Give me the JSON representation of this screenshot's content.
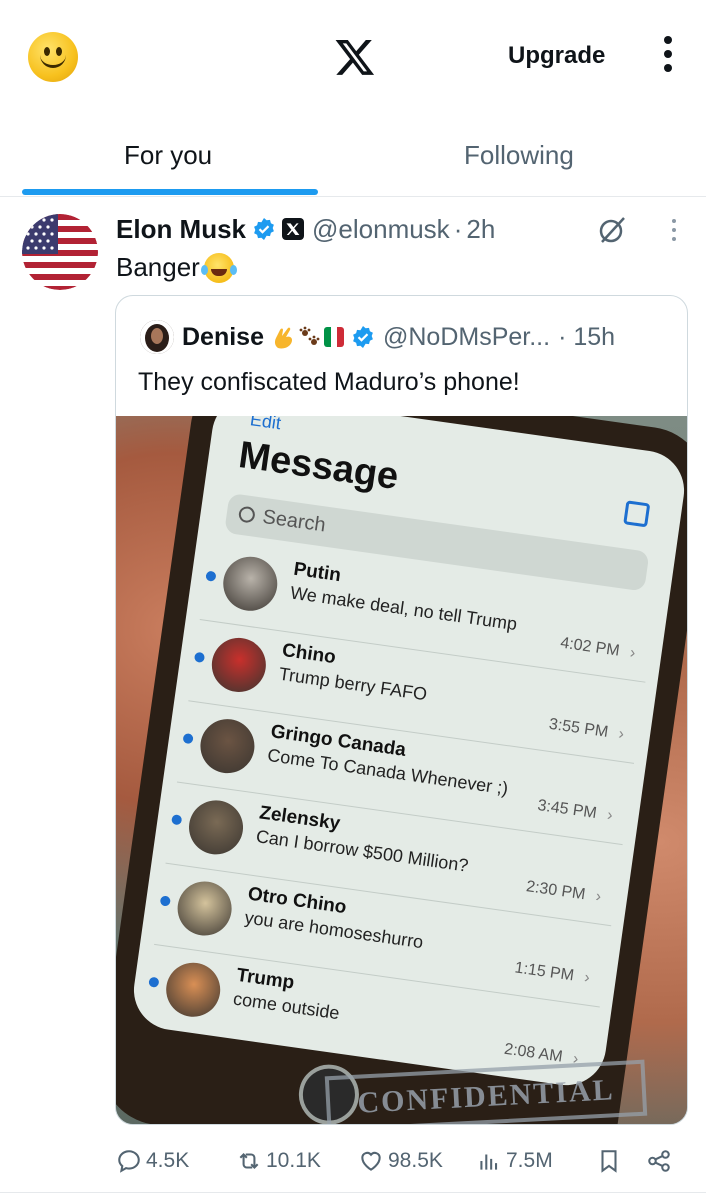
{
  "topbar": {
    "upgrade_label": "Upgrade",
    "icons": [
      "smiley-avatar-icon",
      "x-logo-icon",
      "more-vertical-icon"
    ]
  },
  "tabs": [
    {
      "label": "For you",
      "active": true
    },
    {
      "label": "Following",
      "active": false
    }
  ],
  "accent_color": "#1d9bf0",
  "post": {
    "author_name": "Elon Musk",
    "handle": "@elonmusk",
    "separator": "·",
    "time": "2h",
    "text": "Banger",
    "quote": {
      "author_name": "Denise",
      "handle": "@NoDMsPer...",
      "separator": "·",
      "time": "15h",
      "text": "They confiscated Maduro’s phone!",
      "image": {
        "edit_label": "Edit",
        "title": "Message",
        "search_placeholder": "Search",
        "messages": [
          {
            "name": "Putin",
            "text": "We make deal, no tell Trump",
            "time": "4:02 PM",
            "face_color": "#b9b3aa"
          },
          {
            "name": "Chino",
            "text": "Trump berry FAFO",
            "time": "3:55 PM",
            "face_color": "#c9302c"
          },
          {
            "name": "Gringo Canada",
            "text": "Come To Canada Whenever ;)",
            "time": "3:45 PM",
            "face_color": "#6b5443"
          },
          {
            "name": "Zelensky",
            "text": "Can I borrow $500 Million?",
            "time": "2:30 PM",
            "face_color": "#7a6a55"
          },
          {
            "name": "Otro Chino",
            "text": "you are homoseshurro",
            "time": "1:15 PM",
            "face_color": "#d4c39c"
          },
          {
            "name": "Trump",
            "text": "come outside",
            "time": "2:08 AM",
            "face_color": "#d98f55"
          }
        ],
        "stamp_text": "CONFIDENTIAL"
      }
    },
    "stats": {
      "replies": "4.5K",
      "reposts": "10.1K",
      "likes": "98.5K",
      "views": "7.5M"
    }
  }
}
